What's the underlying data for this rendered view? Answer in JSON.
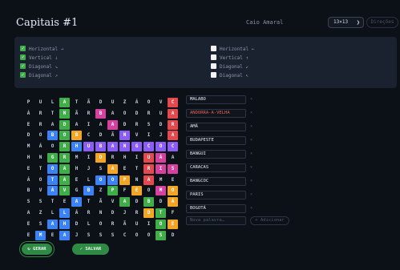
{
  "header": {
    "title": "Capitais #1",
    "author": "Caio Amaral",
    "grid_size": "13×13",
    "directions_button": "Direções"
  },
  "options": {
    "left": [
      {
        "label": "Horizontal →",
        "checked": true
      },
      {
        "label": "Vertical ↓",
        "checked": true
      },
      {
        "label": "Diagonal ↘",
        "checked": true
      },
      {
        "label": "Diagonal ↗",
        "checked": true
      }
    ],
    "right": [
      {
        "label": "Horizontal ←",
        "checked": false
      },
      {
        "label": "Vertical ↑",
        "checked": false
      },
      {
        "label": "Diagonal ↙",
        "checked": false
      },
      {
        "label": "Diagonal ↖",
        "checked": false
      }
    ]
  },
  "grid": {
    "rows": [
      [
        "P",
        "U",
        "L",
        "A",
        "T",
        "Ã",
        "D",
        "U",
        "Z",
        "Á",
        "O",
        "V",
        "C"
      ],
      [
        "Á",
        "R",
        "T",
        "N",
        "Ã",
        "R",
        "B",
        "A",
        "O",
        "D",
        "R",
        "U",
        "A"
      ],
      [
        "E",
        "R",
        "A",
        "D",
        "A",
        "I",
        "A",
        "A",
        "D",
        "R",
        "S",
        "D",
        "R"
      ],
      [
        "D",
        "O",
        "B",
        "O",
        "B",
        "C",
        "D",
        "Ã",
        "N",
        "V",
        "I",
        "J",
        "A"
      ],
      [
        "M",
        "Á",
        "O",
        "R",
        "H",
        "U",
        "B",
        "A",
        "N",
        "G",
        "C",
        "O",
        "C"
      ],
      [
        "H",
        "N",
        "G",
        "R",
        "M",
        "I",
        "D",
        "R",
        "H",
        "I",
        "U",
        "Á",
        "A"
      ],
      [
        "E",
        "T",
        "O",
        "A",
        "H",
        "J",
        "S",
        "A",
        "E",
        "T",
        "R",
        "I",
        "S"
      ],
      [
        "Á",
        "O",
        "T",
        "A",
        "E",
        "L",
        "O",
        "O",
        "P",
        "N",
        "A",
        "M",
        "E"
      ],
      [
        "B",
        "V",
        "Á",
        "V",
        "G",
        "B",
        "Z",
        "P",
        "F",
        "E",
        "O",
        "M",
        "O"
      ],
      [
        "S",
        "S",
        "T",
        "E",
        "A",
        "T",
        "Ã",
        "V",
        "A",
        "D",
        "B",
        "D",
        "Á"
      ],
      [
        "A",
        "Z",
        "L",
        "L",
        "Á",
        "R",
        "N",
        "D",
        "J",
        "R",
        "D",
        "T",
        "F"
      ],
      [
        "E",
        "S",
        "A",
        "H",
        "D",
        "L",
        "O",
        "R",
        "Ã",
        "U",
        "I",
        "O",
        "E"
      ],
      [
        "E",
        "M",
        "E",
        "A",
        "J",
        "S",
        "S",
        "S",
        "C",
        "O",
        "O",
        "S",
        "D"
      ]
    ],
    "highlights": [
      {
        "r": 0,
        "c": 3,
        "color": "#3fae49"
      },
      {
        "r": 1,
        "c": 3,
        "color": "#3fae49"
      },
      {
        "r": 0,
        "c": 12,
        "color": "#e5484d"
      },
      {
        "r": 1,
        "c": 12,
        "color": "#e5484d"
      },
      {
        "r": 2,
        "c": 12,
        "color": "#e5484d"
      },
      {
        "r": 3,
        "c": 12,
        "color": "#e5484d"
      },
      {
        "r": 1,
        "c": 6,
        "color": "#d6409f"
      },
      {
        "r": 2,
        "c": 7,
        "color": "#d6409f"
      },
      {
        "r": 2,
        "c": 3,
        "color": "#3fae49"
      },
      {
        "r": 3,
        "c": 2,
        "color": "#3b82f6"
      },
      {
        "r": 3,
        "c": 3,
        "color": "#3fae49"
      },
      {
        "r": 3,
        "c": 4,
        "color": "#f5a524"
      },
      {
        "r": 3,
        "c": 8,
        "color": "#8b5cf6"
      },
      {
        "r": 4,
        "c": 3,
        "color": "#3fae49"
      },
      {
        "r": 4,
        "c": 4,
        "color": "#3b82f6"
      },
      {
        "r": 4,
        "c": 5,
        "color": "#8b5cf6"
      },
      {
        "r": 4,
        "c": 6,
        "color": "#8b5cf6"
      },
      {
        "r": 4,
        "c": 7,
        "color": "#8b5cf6"
      },
      {
        "r": 4,
        "c": 8,
        "color": "#8b5cf6"
      },
      {
        "r": 4,
        "c": 9,
        "color": "#8b5cf6"
      },
      {
        "r": 4,
        "c": 10,
        "color": "#8b5cf6"
      },
      {
        "r": 4,
        "c": 11,
        "color": "#8b5cf6"
      },
      {
        "r": 4,
        "c": 12,
        "color": "#8b5cf6"
      },
      {
        "r": 5,
        "c": 2,
        "color": "#3fae49"
      },
      {
        "r": 5,
        "c": 3,
        "color": "#3fae49"
      },
      {
        "r": 5,
        "c": 6,
        "color": "#f5a524"
      },
      {
        "r": 5,
        "c": 10,
        "color": "#e5484d"
      },
      {
        "r": 5,
        "c": 11,
        "color": "#d6409f"
      },
      {
        "r": 6,
        "c": 2,
        "color": "#3b82f6"
      },
      {
        "r": 6,
        "c": 3,
        "color": "#3fae49"
      },
      {
        "r": 6,
        "c": 7,
        "color": "#f5a524"
      },
      {
        "r": 6,
        "c": 10,
        "color": "#e5484d"
      },
      {
        "r": 6,
        "c": 11,
        "color": "#d6409f"
      },
      {
        "r": 6,
        "c": 12,
        "color": "#d6409f"
      },
      {
        "r": 7,
        "c": 2,
        "color": "#3b82f6"
      },
      {
        "r": 7,
        "c": 3,
        "color": "#3fae49"
      },
      {
        "r": 7,
        "c": 6,
        "color": "#3b82f6"
      },
      {
        "r": 7,
        "c": 7,
        "color": "#3b82f6"
      },
      {
        "r": 7,
        "c": 8,
        "color": "#f5a524"
      },
      {
        "r": 7,
        "c": 10,
        "color": "#e5484d"
      },
      {
        "r": 8,
        "c": 2,
        "color": "#3b82f6"
      },
      {
        "r": 8,
        "c": 3,
        "color": "#3fae49"
      },
      {
        "r": 8,
        "c": 5,
        "color": "#3b82f6"
      },
      {
        "r": 8,
        "c": 7,
        "color": "#3fae49"
      },
      {
        "r": 8,
        "c": 9,
        "color": "#f5a524"
      },
      {
        "r": 8,
        "c": 11,
        "color": "#d6409f"
      },
      {
        "r": 8,
        "c": 12,
        "color": "#f5a524"
      },
      {
        "r": 9,
        "c": 4,
        "color": "#3b82f6"
      },
      {
        "r": 9,
        "c": 8,
        "color": "#3fae49"
      },
      {
        "r": 9,
        "c": 10,
        "color": "#3fae49"
      },
      {
        "r": 9,
        "c": 12,
        "color": "#f5a524"
      },
      {
        "r": 10,
        "c": 3,
        "color": "#3b82f6"
      },
      {
        "r": 10,
        "c": 10,
        "color": "#f5a524"
      },
      {
        "r": 10,
        "c": 11,
        "color": "#3fae49"
      },
      {
        "r": 11,
        "c": 2,
        "color": "#3b82f6"
      },
      {
        "r": 11,
        "c": 3,
        "color": "#3b82f6"
      },
      {
        "r": 11,
        "c": 11,
        "color": "#3fae49"
      },
      {
        "r": 11,
        "c": 12,
        "color": "#f5a524"
      },
      {
        "r": 12,
        "c": 1,
        "color": "#3b82f6"
      },
      {
        "r": 12,
        "c": 3,
        "color": "#3b82f6"
      },
      {
        "r": 12,
        "c": 11,
        "color": "#3fae49"
      }
    ]
  },
  "words": [
    {
      "text": "MALABO",
      "error": false
    },
    {
      "text": "ANDORRA-A-VELHA",
      "error": true
    },
    {
      "text": "AMÃ",
      "error": false
    },
    {
      "text": "BUDAPESTE",
      "error": false
    },
    {
      "text": "BANGUI",
      "error": false
    },
    {
      "text": "CARACAS",
      "error": false
    },
    {
      "text": "BANGCOC",
      "error": false
    },
    {
      "text": "PARIS",
      "error": false
    },
    {
      "text": "BOGOTÁ",
      "error": false
    }
  ],
  "word_remove_glyph": "×",
  "new_word": {
    "placeholder": "Nova palavra…"
  },
  "add_button": "+ Adicionar",
  "actions": {
    "generate": "↻ GERAR",
    "save": "✓ SALVAR"
  }
}
